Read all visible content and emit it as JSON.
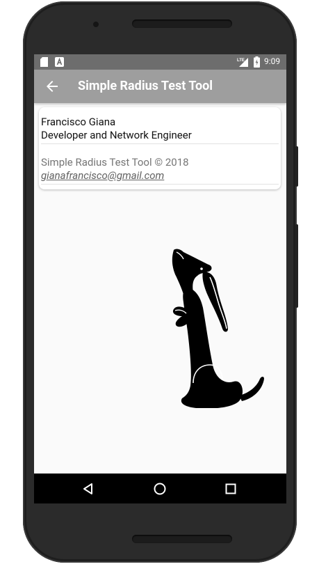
{
  "status_bar": {
    "time": "9:09",
    "network": "LTE",
    "left_icons": [
      "sd-card-icon",
      "a-notification-icon"
    ]
  },
  "app_bar": {
    "title": "Simple Radius Test Tool",
    "back_icon": "arrow-back-icon"
  },
  "about_card": {
    "name": "Francisco Giana",
    "role": "Developer and Network Engineer",
    "copyright": "Simple Radius Test Tool © 2018",
    "email": "gianafrancisco@gmail.com"
  },
  "illustration": "dachshund-silhouette",
  "nav_bar": {
    "buttons": [
      "back-triangle-icon",
      "home-circle-icon",
      "recents-square-icon"
    ]
  },
  "colors": {
    "app_bar": "#9e9e9e",
    "status_bar": "#6d6d6d",
    "screen_bg": "#fafafa",
    "nav_bar": "#000000"
  }
}
